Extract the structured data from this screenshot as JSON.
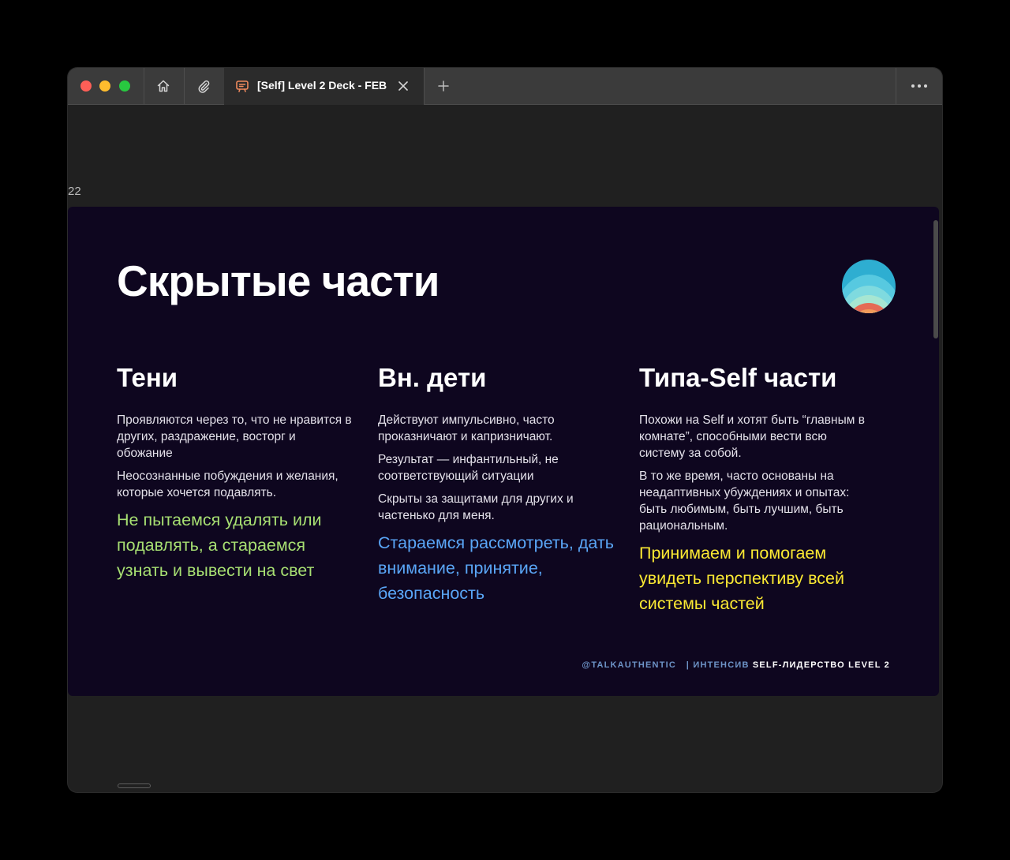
{
  "window": {
    "tab": {
      "title": "[Self] Level 2 Deck - FEB",
      "icon": "presentation-icon"
    },
    "toolbar_icons": [
      "home-icon",
      "paperclip-icon",
      "plus-icon",
      "more-icon"
    ]
  },
  "viewer": {
    "page_number": "22"
  },
  "slide": {
    "title": "Скрытые части",
    "columns": [
      {
        "heading": "Тени",
        "paragraphs": [
          "Проявляются через то, что не нравится в других, раздражение, восторг и обожание",
          "Неосознанные побуждения и желания, которые хочется подавлять."
        ],
        "highlight": "Не пытаемся удалять или подавлять, а стараемся узнать и вывести на свет",
        "highlight_color": "#a7df72"
      },
      {
        "heading": "Вн. дети",
        "paragraphs": [
          "Действуют импульсивно, часто проказничают и капризничают.",
          "Результат — инфантильный, не соответствующий ситуации",
          "Скрыты за защитами для других и частенько для меня."
        ],
        "highlight": "Стараемся рассмотреть, дать внимание, принятие, безопасность",
        "highlight_color": "#5aa6f7"
      },
      {
        "heading": "Типа-Self части",
        "paragraphs": [
          "Похожи на Self и хотят быть “главным в комнате”, способными вести всю систему за собой.",
          "В то же время, часто основаны на неадаптивных убуждениях и опытах: быть любимым, быть лучшим, быть рациональным."
        ],
        "highlight": "Принимаем и помогаем увидеть перспективу всей системы частей",
        "highlight_color": "#fbe933"
      }
    ],
    "footer": {
      "handle": "@TALKAUTHENTIC",
      "separator": "|",
      "course": "ИНТЕНСИВ",
      "brand": "SELF-ЛИДЕРСТВО LEVEL 2"
    },
    "colors": {
      "background": "#0e061f",
      "text": "#ffffff"
    }
  }
}
